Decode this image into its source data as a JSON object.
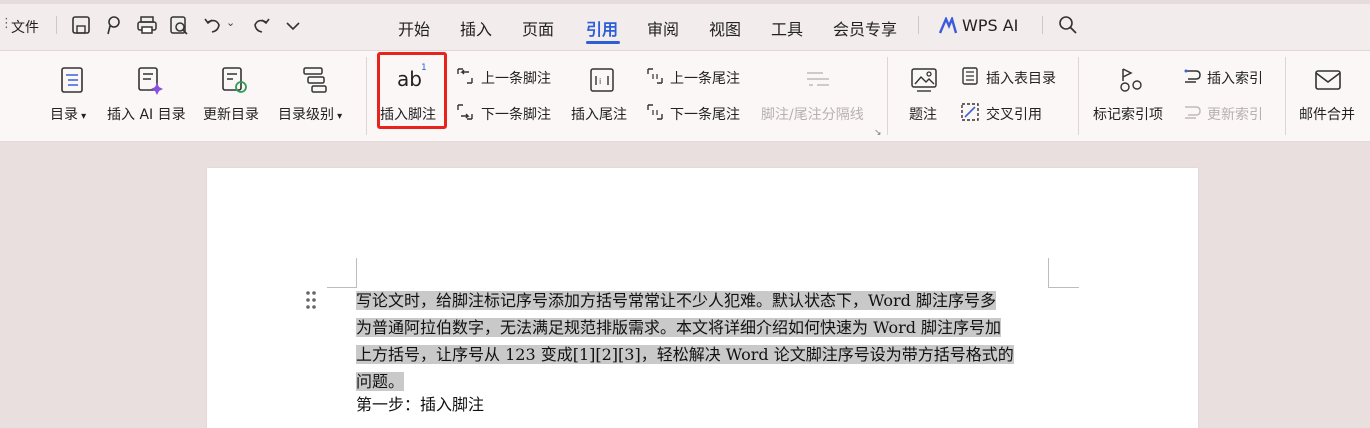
{
  "quick": {
    "file_label": "文件"
  },
  "tabs": [
    {
      "label": "开始"
    },
    {
      "label": "插入"
    },
    {
      "label": "页面"
    },
    {
      "label": "引用"
    },
    {
      "label": "审阅"
    },
    {
      "label": "视图"
    },
    {
      "label": "工具"
    },
    {
      "label": "会员专享"
    },
    {
      "label": "WPS AI"
    }
  ],
  "ribbon": {
    "toc": "目录",
    "insert_ai_toc": "插入 AI 目录",
    "update_toc": "更新目录",
    "toc_level": "目录级别",
    "insert_footnote": "插入脚注",
    "prev_footnote": "上一条脚注",
    "next_footnote": "下一条脚注",
    "insert_endnote": "插入尾注",
    "prev_endnote": "上一条尾注",
    "next_endnote": "下一条尾注",
    "separator": "脚注/尾注分隔线",
    "caption": "题注",
    "insert_table_toc": "插入表目录",
    "cross_ref": "交叉引用",
    "mark_index": "标记索引项",
    "insert_index": "插入索引",
    "update_index": "更新索引",
    "mail_merge": "邮件合并"
  },
  "doc": {
    "para_lines": [
      "写论文时，给脚注标记序号添加方括号常常让不少人犯难。默认状态下，Word 脚注序号多",
      "为普通阿拉伯数字，无法满足规范排版需求。本文将详细介绍如何快速为 Word 脚注序号加",
      "上方括号，让序号从 123 变成[1][2][3]，轻松解决 Word 论文脚注序号设为带方括号格式的",
      "问题。"
    ],
    "step1": "第一步：插入脚注"
  },
  "colors": {
    "accent": "#2c5ed8",
    "highlight_box": "#e8231b"
  }
}
